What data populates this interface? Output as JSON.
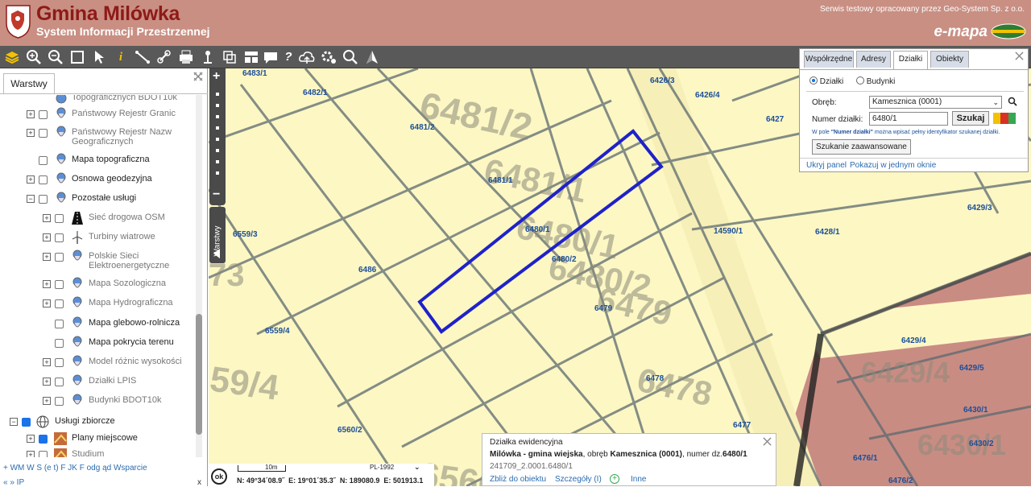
{
  "header": {
    "title": "Gmina Milówka",
    "subtitle": "System Informacji Przestrzennej",
    "service_note": "Serwis testowy opracowany przez Geo-System Sp. z o.o.",
    "brand": "e-mapa"
  },
  "sidebar": {
    "tab_label": "Warstwy",
    "items": [
      {
        "label": "Topograficznych BDOT10k",
        "dim": true
      },
      {
        "label": "Państwowy Rejestr Granic",
        "dim": true
      },
      {
        "label": "Państwowy Rejestr Nazw Geograficznych",
        "dim": true
      },
      {
        "label": "Mapa topograficzna",
        "dim": false
      },
      {
        "label": "Osnowa geodezyjna",
        "dim": false
      },
      {
        "label": "Pozostałe usługi",
        "dim": false
      },
      {
        "label": "Sieć drogowa OSM",
        "dim": true
      },
      {
        "label": "Turbiny wiatrowe",
        "dim": true
      },
      {
        "label": "Polskie Sieci Elektroenergetyczne",
        "dim": true
      },
      {
        "label": "Mapa Sozologiczna",
        "dim": true
      },
      {
        "label": "Mapa Hydrograficzna",
        "dim": true
      },
      {
        "label": "Mapa glebowo-rolnicza",
        "dim": false
      },
      {
        "label": "Mapa pokrycia terenu",
        "dim": false
      },
      {
        "label": "Model różnic wysokości",
        "dim": true
      },
      {
        "label": "Działki LPIS",
        "dim": true
      },
      {
        "label": "Budynki BDOT10k",
        "dim": true
      },
      {
        "label": "Usługi zbiorcze",
        "dim": false
      },
      {
        "label": "Plany miejscowe",
        "dim": false
      },
      {
        "label": "Studium",
        "dim": true
      }
    ],
    "bottom_links": "+ WM  W S (e t)  F JK  F odg ąd  Wsparcie",
    "bottom_links2": "« »  IP"
  },
  "map": {
    "parcel_labels": [
      "6483/1",
      "6482/1",
      "6481/2",
      "6481/1",
      "6480/1",
      "6480/2",
      "6479",
      "6478",
      "6477",
      "6486",
      "6559/3",
      "6559/4",
      "6560/2",
      "6426/3",
      "6426/4",
      "6427",
      "14590/1",
      "6428/1",
      "6429/3",
      "6429/4",
      "6429/5",
      "6430/1",
      "6430/2",
      "6476/1",
      "6476/2"
    ],
    "layers_tab": "Warstwy",
    "scale": "10m",
    "crs": "PL-1992",
    "coords": {
      "ok": "ok",
      "n": "N: 49°34´08.9˝",
      "e": "E: 19°01´35.3˝",
      "n2": "N: 189080.9",
      "e2": "E: 501913.1"
    }
  },
  "search_panel": {
    "tabs": [
      "Współrzędne",
      "Adresy",
      "Działki",
      "Obiekty"
    ],
    "active_tab": "Działki",
    "radio_parcels": "Działki",
    "radio_buildings": "Budynki",
    "obreb_label": "Obręb:",
    "obreb_value": "Kamesznica (0001)",
    "numer_label": "Numer działki:",
    "numer_value": "6480/1",
    "search_button": "Szukaj",
    "hint_prefix": "W pole ",
    "hint_field": "\"Numer działki\"",
    "hint_suffix": " można wpisać pełny identyfikator szukanej działki.",
    "advanced_button": "Szukanie zaawansowane",
    "hide_link": "Ukryj panel",
    "single_window_link": "Pokazuj w jednym oknie"
  },
  "info_panel": {
    "title": "Działka ewidencyjna",
    "line_bold1": "Milówka - gmina wiejska",
    "line_mid": ", obręb ",
    "line_bold2": "Kamesznica (0001)",
    "line_mid2": ", numer dz.",
    "line_bold3": "6480/1",
    "id": "241709_2.0001.6480/1",
    "link_zoom": "Zbliż do obiektu",
    "link_details": "Szczegóły (I)",
    "link_other": "Inne"
  }
}
